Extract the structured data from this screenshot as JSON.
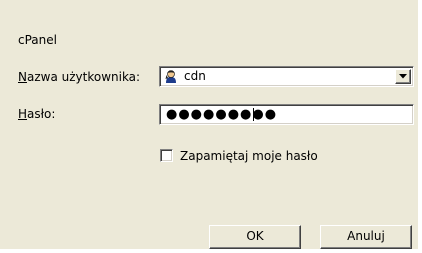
{
  "dialog": {
    "realm": "cPanel"
  },
  "fields": {
    "username": {
      "label_accel": "N",
      "label_rest": "azwa użytkownika:",
      "value": "cdn",
      "icon": "user-icon"
    },
    "password": {
      "label_accel": "H",
      "label_rest": "asło:",
      "masked_value": "●●●●●●●●●"
    }
  },
  "remember": {
    "label": "Zapamiętaj moje hasło",
    "checked": false
  },
  "buttons": {
    "ok": "OK",
    "cancel": "Anuluj"
  },
  "icons": {
    "dropdown": "chevron-down-icon",
    "user": "user-icon"
  }
}
